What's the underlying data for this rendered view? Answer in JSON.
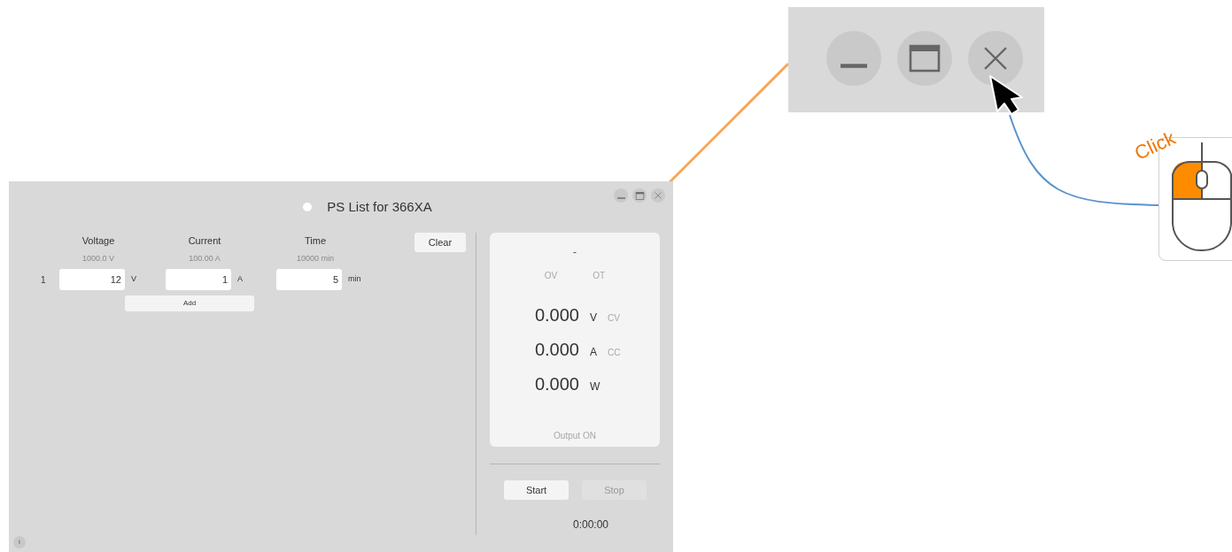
{
  "window": {
    "title": "PS List for 366XA"
  },
  "list": {
    "columns": [
      {
        "label": "Voltage",
        "max": "1000.0 V"
      },
      {
        "label": "Current",
        "max": "100.00 A"
      },
      {
        "label": "Time",
        "max": "10000 min"
      }
    ],
    "rows": [
      {
        "index": "1",
        "fields": [
          {
            "value": "12",
            "unit": "V"
          },
          {
            "value": "1",
            "unit": "A"
          },
          {
            "value": "5",
            "unit": "min"
          }
        ]
      }
    ],
    "add_button": "Add",
    "clear_button": "Clear"
  },
  "monitor": {
    "status": "-",
    "flags": [
      {
        "label": "OV",
        "active": false
      },
      {
        "label": "OT",
        "active": false
      }
    ],
    "readings": [
      {
        "value": "0.000",
        "unit": "V",
        "mode": {
          "label": "CV",
          "active": false
        }
      },
      {
        "value": "0.000",
        "unit": "A",
        "mode": {
          "label": "CC",
          "active": false
        }
      },
      {
        "value": "0.000",
        "unit": "W"
      }
    ],
    "output": {
      "label": "Output ON",
      "active": false
    }
  },
  "controls": {
    "buttons": [
      {
        "label": "Start",
        "disabled": false
      },
      {
        "label": "Stop",
        "disabled": true
      }
    ],
    "timer": "0:00:00"
  },
  "info_button": "i",
  "annotation": {
    "label": "Click"
  }
}
